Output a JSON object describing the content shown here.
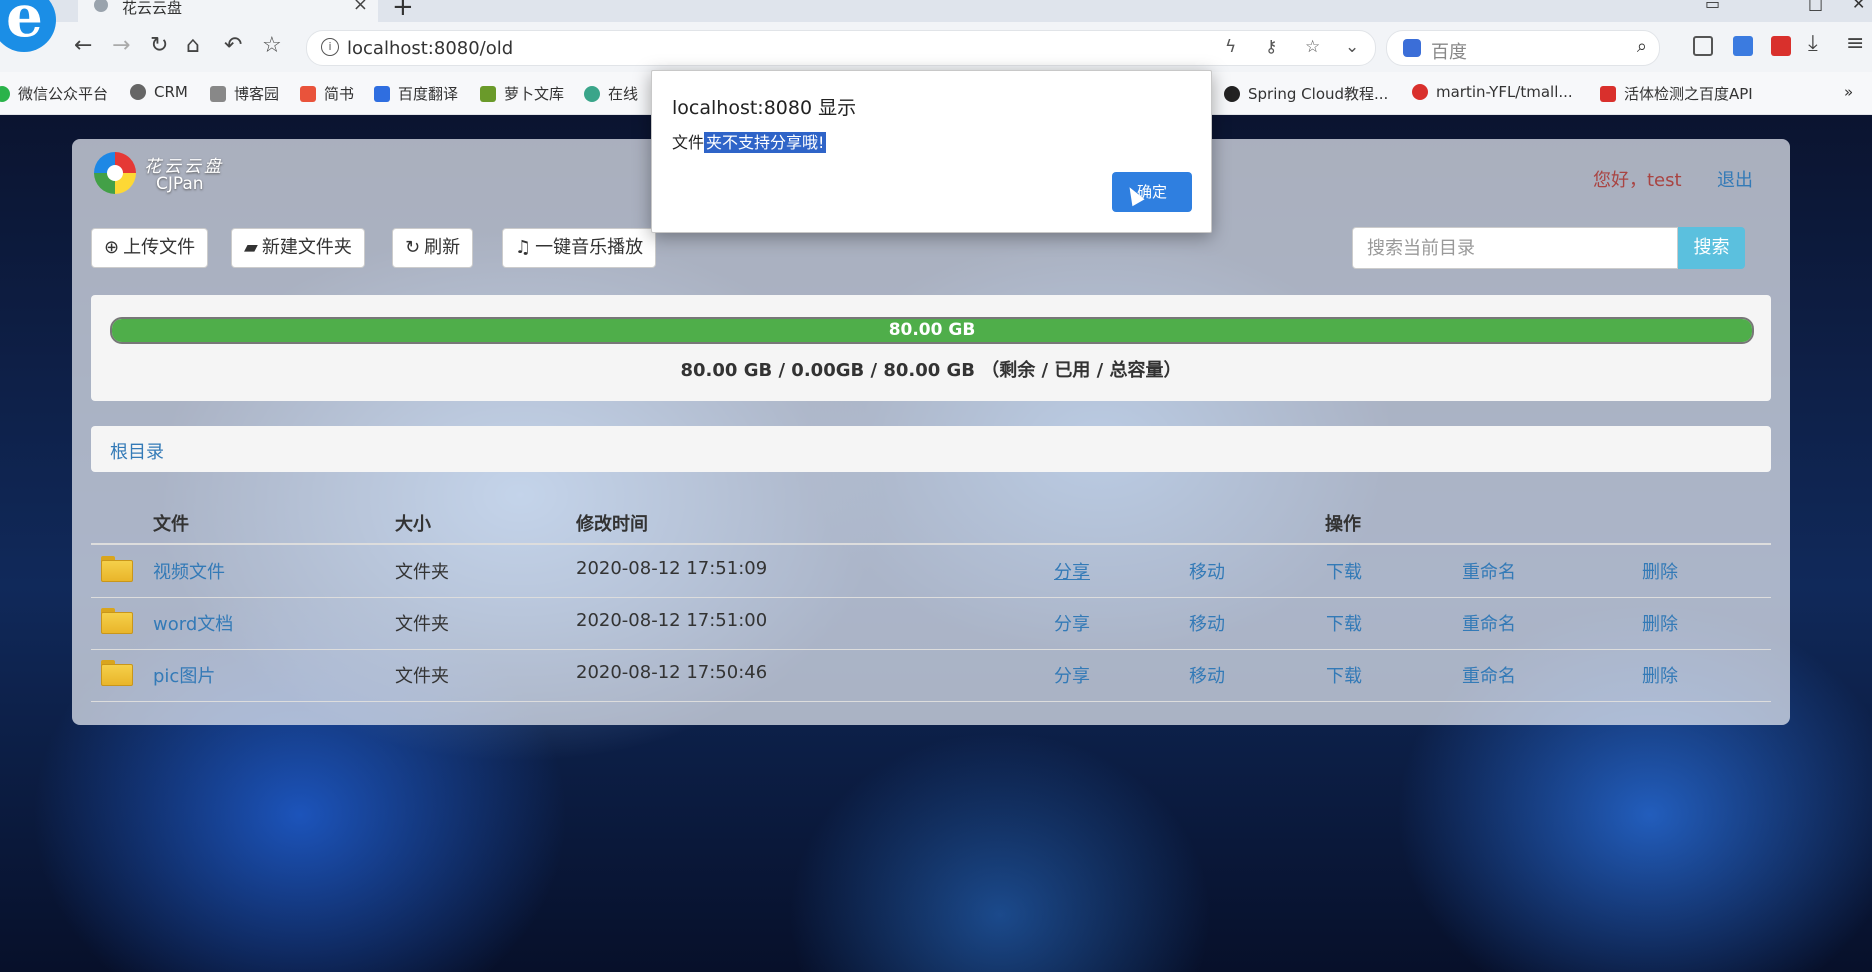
{
  "browser": {
    "tab_title": "花云云盘",
    "new_tab": "+",
    "url": "localhost:8080/old",
    "url_info": "i",
    "search_engine": "百度",
    "bookmarks": [
      "微信公众平台",
      "CRM",
      "博客园",
      "简书",
      "百度翻译",
      "萝卜文库",
      "在线",
      "Spring Cloud教程...",
      "martin-YFL/tmall...",
      "活体检测之百度API"
    ],
    "bookmarks_more": "»"
  },
  "dialog": {
    "title": "localhost:8080 显示",
    "message_plain": "文件",
    "message_selected": "夹不支持分享哦!",
    "ok_label": "确定"
  },
  "app": {
    "logo_name": "花云云盘",
    "logo_sub": "CJPan",
    "greeting": "您好，test",
    "logout": "退出",
    "toolbar": {
      "upload": "上传文件",
      "new_folder": "新建文件夹",
      "refresh": "刷新",
      "music": "一键音乐播放"
    },
    "search": {
      "placeholder": "搜索当前目录",
      "button": "搜索"
    },
    "quota": {
      "percent_free": 100,
      "bar_label": "80.00 GB",
      "summary": "80.00 GB / 0.00GB / 80.00 GB （剩余 / 已用 / 总容量）",
      "bar_color": "#4fae4a"
    },
    "breadcrumb": "根目录",
    "table": {
      "headers": {
        "file": "文件",
        "size": "大小",
        "modified": "修改时间",
        "actions": "操作"
      },
      "rows": [
        {
          "name": "视频文件",
          "size": "文件夹",
          "modified": "2020-08-12 17:51:09"
        },
        {
          "name": "word文档",
          "size": "文件夹",
          "modified": "2020-08-12 17:51:00"
        },
        {
          "name": "pic图片",
          "size": "文件夹",
          "modified": "2020-08-12 17:50:46"
        }
      ],
      "actions": {
        "share": "分享",
        "move": "移动",
        "download": "下载",
        "rename": "重命名",
        "delete": "删除"
      }
    }
  },
  "colors": {
    "link": "#337ab7",
    "greeting": "#a94442",
    "search_btn": "#5bc0de",
    "dialog_btn": "#2f7fe0"
  }
}
